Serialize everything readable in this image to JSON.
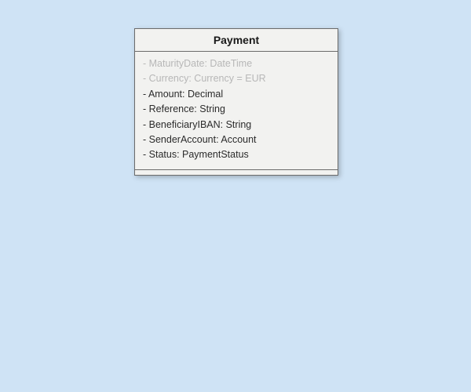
{
  "class": {
    "name": "Payment",
    "attributes": [
      {
        "text": "- MaturityDate: DateTime",
        "inherited": true
      },
      {
        "text": "- Currency: Currency = EUR",
        "inherited": true
      },
      {
        "text": "- Amount: Decimal",
        "inherited": false
      },
      {
        "text": "- Reference: String",
        "inherited": false
      },
      {
        "text": "- BeneficiaryIBAN: String",
        "inherited": false
      },
      {
        "text": "- SenderAccount: Account",
        "inherited": false
      },
      {
        "text": "- Status: PaymentStatus",
        "inherited": false
      }
    ]
  }
}
